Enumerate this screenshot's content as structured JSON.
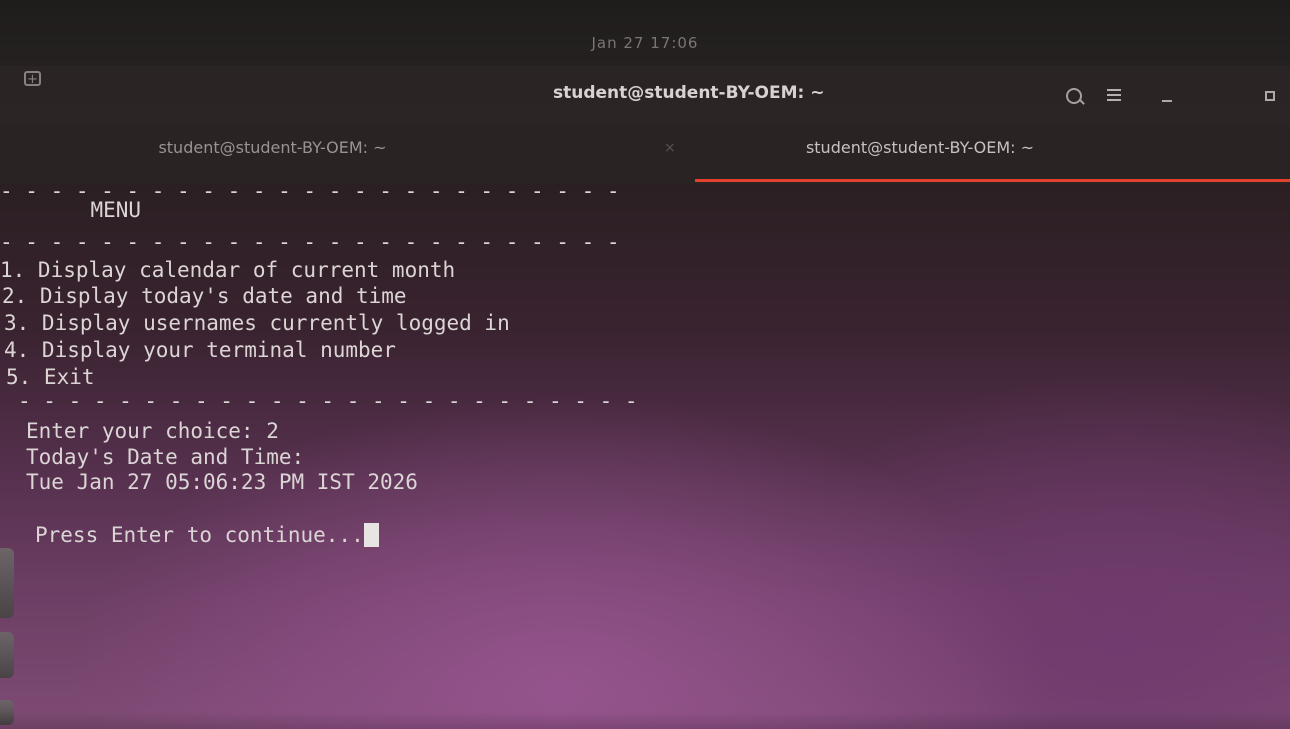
{
  "topbar": {
    "clock": "Jan 27  17:06"
  },
  "header": {
    "title": "student@student-BY-OEM: ~"
  },
  "tabs": [
    {
      "label": "student@student-BY-OEM: ~",
      "close": "×"
    },
    {
      "label": "student@student-BY-OEM: ~"
    }
  ],
  "terminal": {
    "lines": [
      "- - - - - - - - - - - - - - - - - - - - - - - - -",
      "       MENU",
      "- - - - - - - - - - - - - - - - - - - - - - - - -",
      "1. Display calendar of current month",
      "2. Display today's date and time",
      "3. Display usernames currently logged in",
      "4. Display your terminal number",
      "5. Exit",
      "- - - - - - - - - - - - - - - - - - - - - - - - -",
      "Enter your choice: 2",
      "Today's Date and Time:",
      "Tue Jan 27 05:06:23 PM IST 2026",
      "",
      "Press Enter to continue..."
    ]
  },
  "colors": {
    "tab_indicator": "#e2412f",
    "terminal_text": "#dcd5d5",
    "terminal_bg_bottom": "#7e4b74"
  },
  "icons": [
    "new-tab-icon",
    "search-icon",
    "hamburger-menu-icon",
    "minimize-icon",
    "maximize-icon",
    "terminal-cursor"
  ]
}
